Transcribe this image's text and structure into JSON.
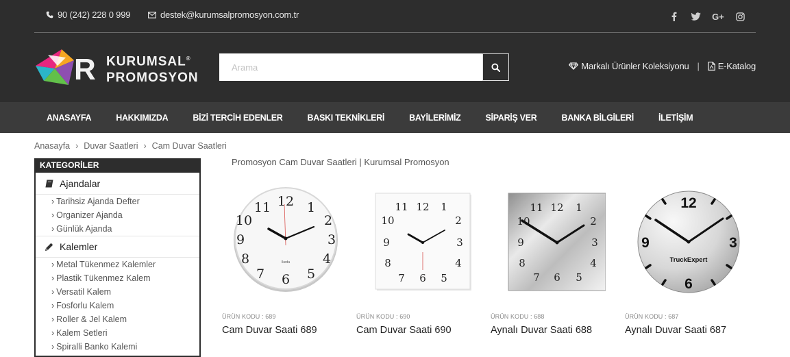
{
  "topbar": {
    "phone": "90 (242) 228 0 999",
    "email": "destek@kurumsalpromosyon.com.tr",
    "social": [
      {
        "icon": "facebook-icon",
        "glyph": "f"
      },
      {
        "icon": "twitter-icon",
        "glyph": "t"
      },
      {
        "icon": "google-plus-icon",
        "glyph": "G+"
      },
      {
        "icon": "instagram-icon",
        "glyph": ""
      }
    ]
  },
  "logo": {
    "line1": "KURUMSAL",
    "reg": "®",
    "line2": "PROMOSYON"
  },
  "search": {
    "placeholder": "Arama",
    "value": ""
  },
  "headlinks": {
    "brands": "Markalı Ürünler Koleksiyonu",
    "separator": "|",
    "catalog": "E-Katalog"
  },
  "nav": [
    "ANASAYFA",
    "HAKKIMIZDA",
    "BİZİ TERCİH EDENLER",
    "BASKI TEKNİKLERİ",
    "BAYİLERİMİZ",
    "SİPARİŞ VER",
    "BANKA BİLGİLERİ",
    "İLETİŞİM"
  ],
  "breadcrumb": [
    "Anasayfa",
    "Duvar Saatleri",
    "Cam Duvar Saatleri"
  ],
  "sidebar": {
    "title": "KATEGORİLER",
    "categories": [
      {
        "label": "Ajandalar",
        "icon": "book-icon",
        "items": [
          "Tarihsiz Ajanda Defter",
          "Organizer Ajanda",
          "Günlük Ajanda"
        ]
      },
      {
        "label": "Kalemler",
        "icon": "pen-icon",
        "items": [
          "Metal Tükenmez Kalemler",
          "Plastik Tükenmez Kalem",
          "Versatil Kalem",
          "Fosforlu Kalem",
          "Roller & Jel Kalem",
          "Kalem Setleri",
          "Spiralli Banko Kalemi"
        ]
      }
    ]
  },
  "page_title": "Promosyon Cam Duvar Saatleri | Kurumsal Promosyon",
  "products": [
    {
      "code": "ÜRÜN KODU : 689",
      "name": "Cam Duvar Saati 689",
      "style": "round-white"
    },
    {
      "code": "ÜRÜN KODU : 690",
      "name": "Cam Duvar Saati 690",
      "style": "square-white"
    },
    {
      "code": "ÜRÜN KODU : 688",
      "name": "Aynalı Duvar Saati 688",
      "style": "square-mirror"
    },
    {
      "code": "ÜRÜN KODU : 687",
      "name": "Aynalı Duvar Saati 687",
      "style": "round-mirror",
      "brand": "TruckExpert"
    }
  ],
  "colors": {
    "header_bg": "#2d2d2d",
    "nav_bg": "#3b3b3b",
    "accent_hand": "#d9534f"
  }
}
